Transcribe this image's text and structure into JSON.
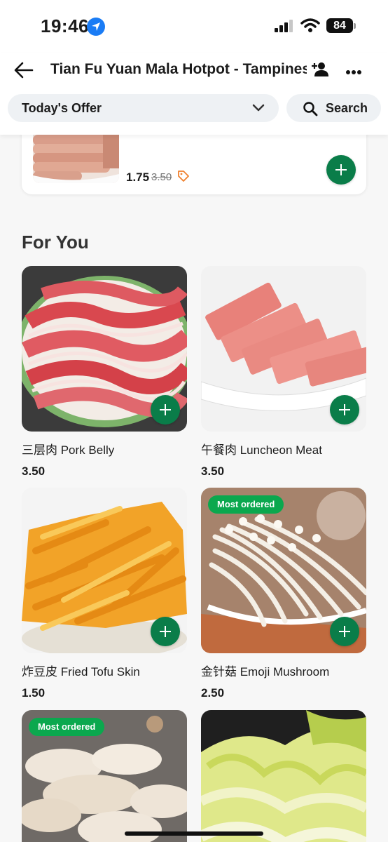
{
  "status_bar": {
    "time": "19:46",
    "battery": "84"
  },
  "header": {
    "title": "Tian Fu Yuan Mala Hotpot - Tampines I",
    "offer_dropdown": "Today's Offer",
    "search_label": "Search"
  },
  "offer_item": {
    "price": "1.75",
    "old_price": "3.50"
  },
  "section": {
    "title": "For You"
  },
  "items": [
    {
      "name": "三层肉 Pork Belly",
      "price": "3.50",
      "badge": ""
    },
    {
      "name": "午餐肉 Luncheon Meat",
      "price": "3.50",
      "badge": ""
    },
    {
      "name": "炸豆皮 Fried Tofu Skin",
      "price": "1.50",
      "badge": ""
    },
    {
      "name": "金针菇 Emoji Mushroom",
      "price": "2.50",
      "badge": "Most ordered"
    },
    {
      "name": "",
      "price": "",
      "badge": "Most ordered"
    },
    {
      "name": "",
      "price": "",
      "badge": ""
    }
  ],
  "colors": {
    "accent_green": "#0a7d49",
    "badge_green": "#0ba84e",
    "tag_orange": "#f0812f"
  }
}
